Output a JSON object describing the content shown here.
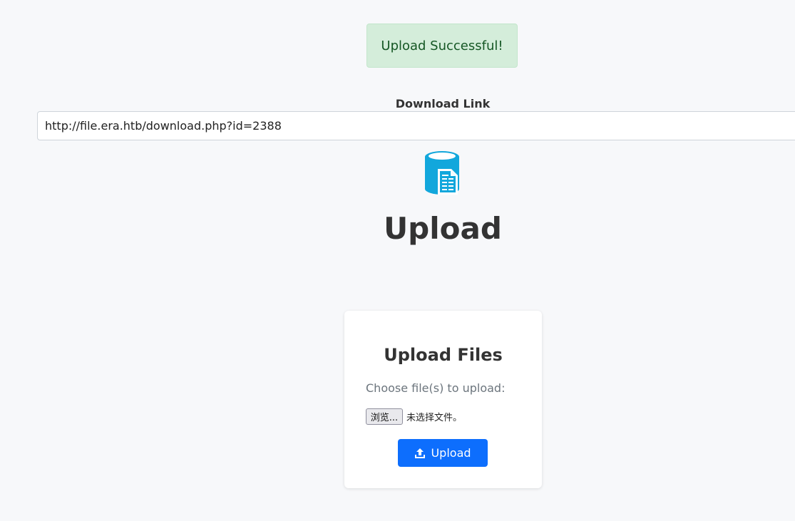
{
  "alert": {
    "text": "Upload Successful!"
  },
  "download": {
    "label": "Download Link",
    "url": "http://file.era.htb/download.php?id=2388"
  },
  "header": {
    "logo_icon": "database-document-icon",
    "title": "Upload"
  },
  "card": {
    "title": "Upload Files",
    "choose_label": "Choose file(s) to upload:",
    "browse_label": "浏览...",
    "no_file_text": "未选择文件。",
    "upload_button": "Upload",
    "upload_icon": "upload-icon"
  },
  "colors": {
    "alert_bg": "#d4edda",
    "alert_text": "#155724",
    "accent": "#0d6efd",
    "logo": "#12a7dc"
  }
}
